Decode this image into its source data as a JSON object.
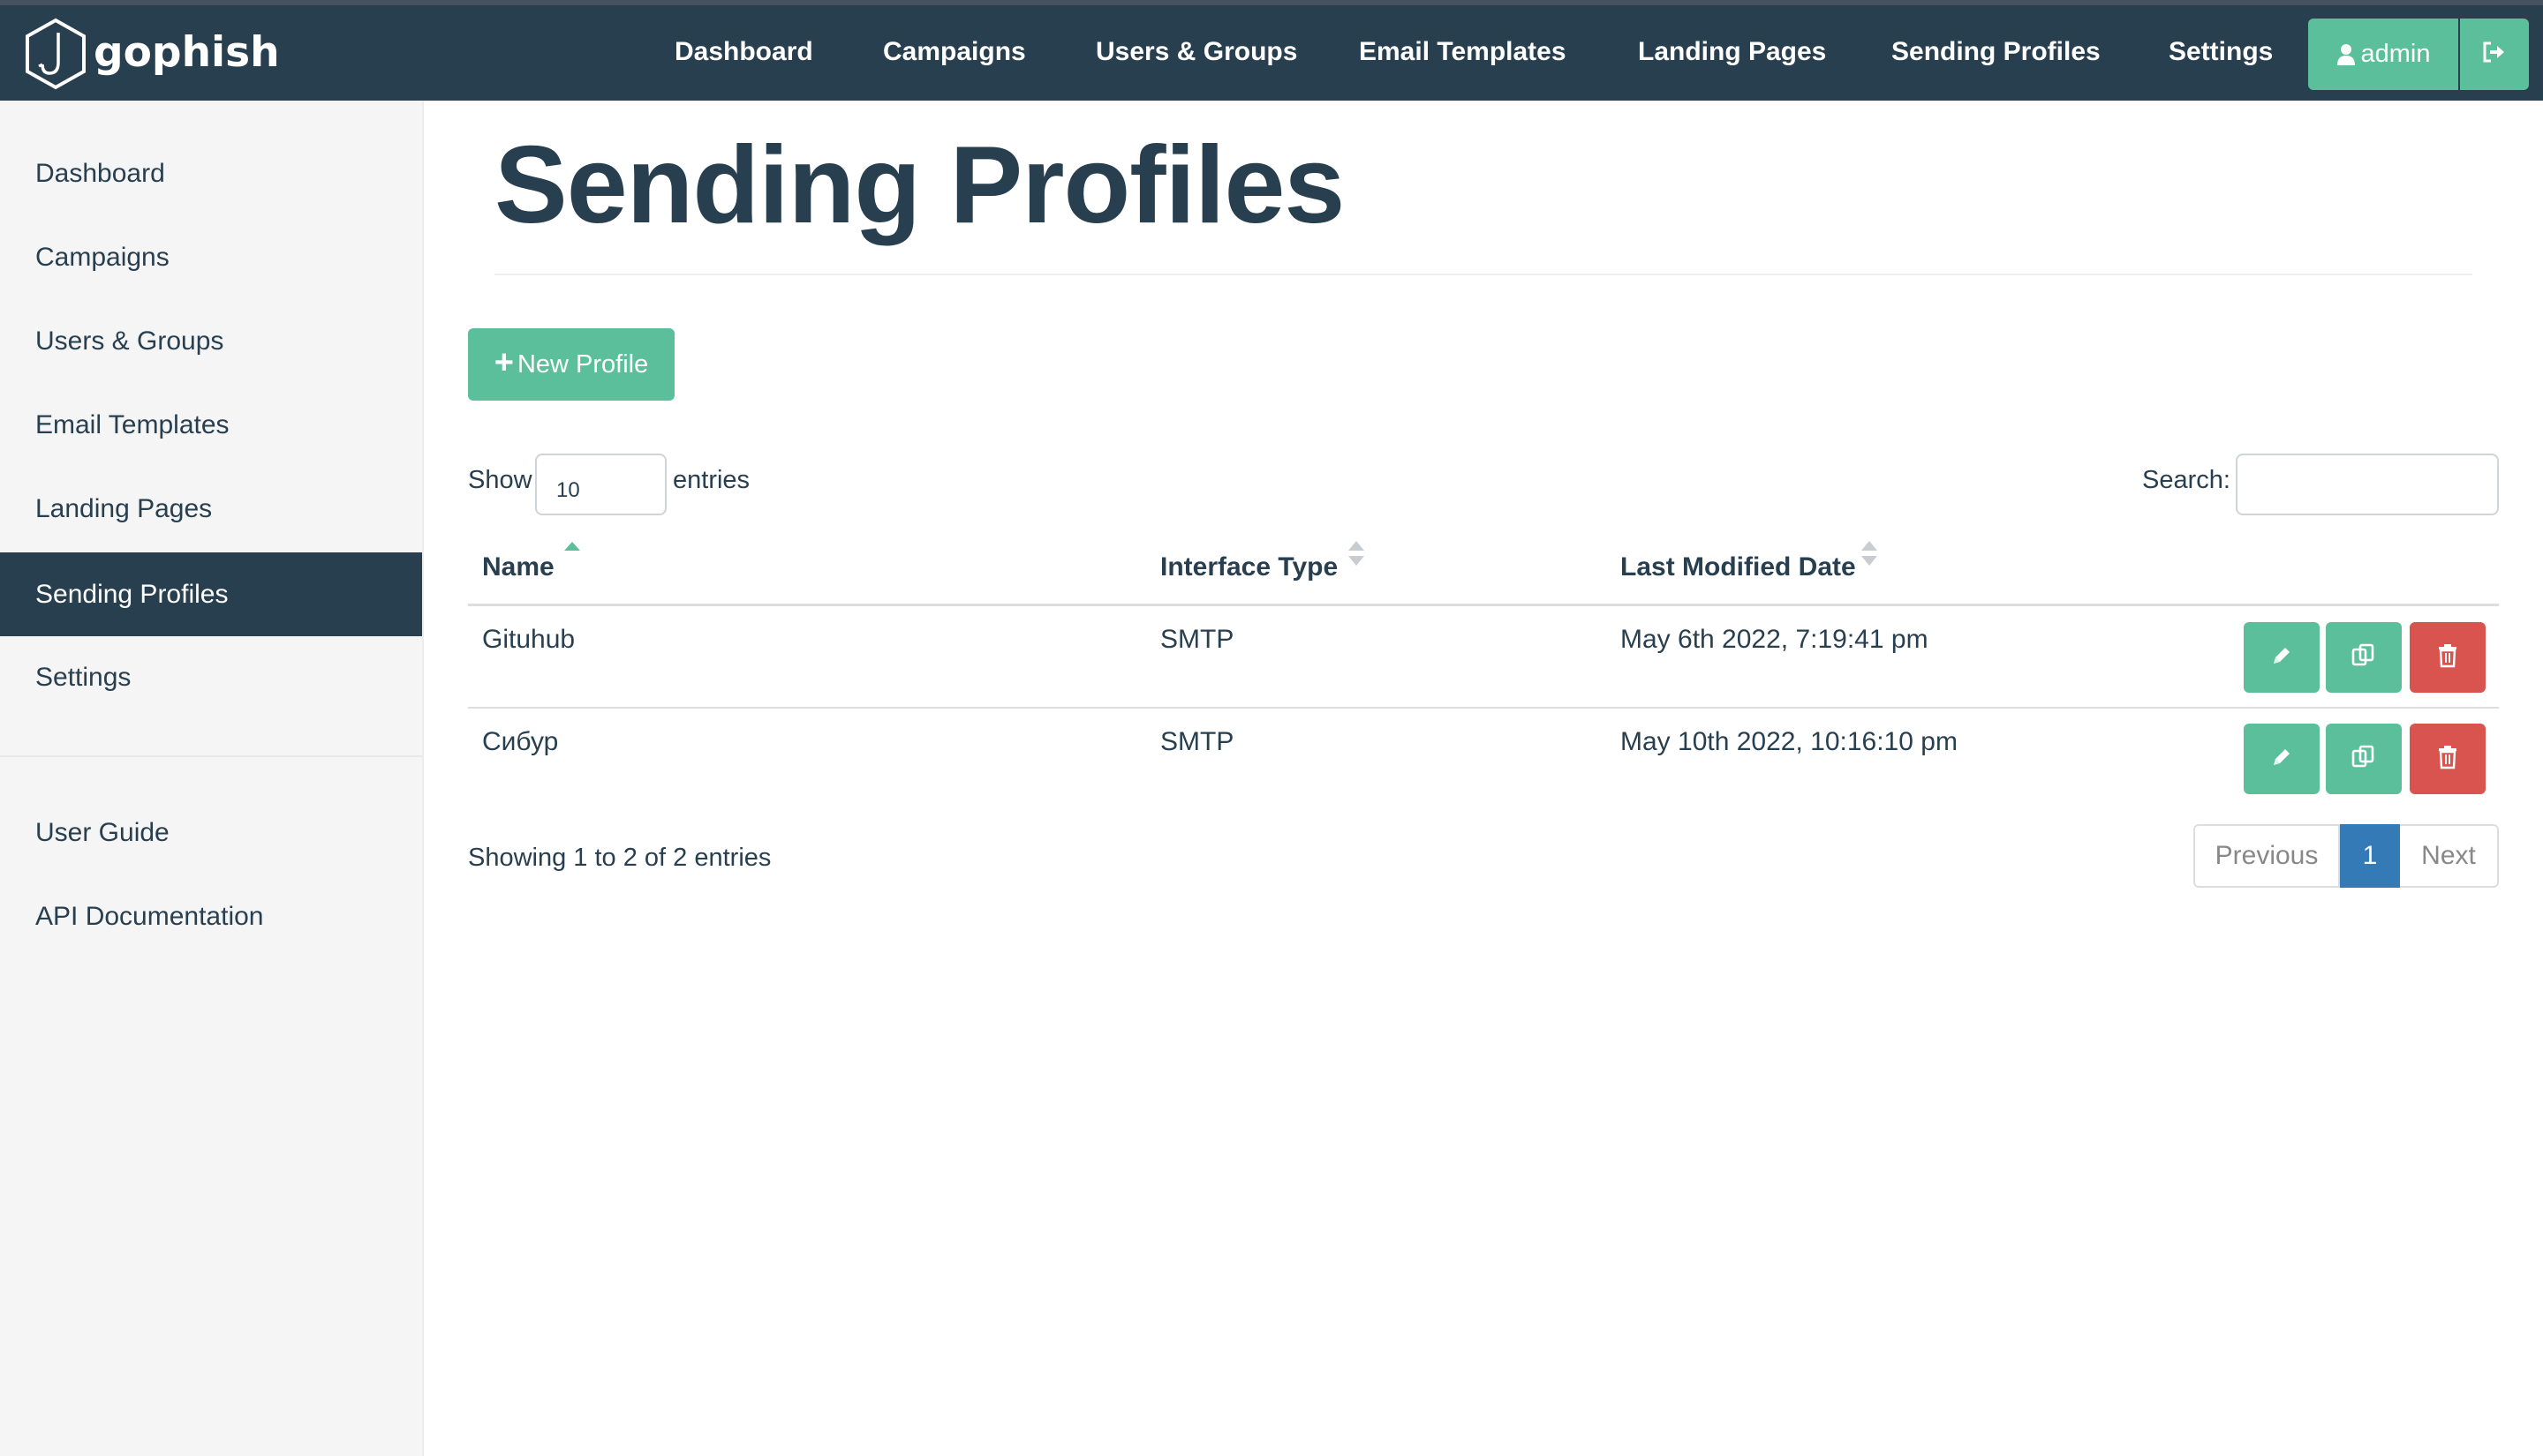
{
  "brand": {
    "name": "gophish"
  },
  "navbar": {
    "links": [
      "Dashboard",
      "Campaigns",
      "Users & Groups",
      "Email Templates",
      "Landing Pages",
      "Sending Profiles",
      "Settings"
    ],
    "user_label": "admin"
  },
  "sidebar": {
    "items": [
      "Dashboard",
      "Campaigns",
      "Users & Groups",
      "Email Templates",
      "Landing Pages",
      "Sending Profiles",
      "Settings"
    ],
    "active_item": "Sending Profiles",
    "help_items": [
      "User Guide",
      "API Documentation"
    ]
  },
  "page": {
    "title": "Sending Profiles",
    "new_button_label": "New Profile"
  },
  "table_controls": {
    "show_label": "Show",
    "page_length": "10",
    "entries_label": "entries",
    "search_label": "Search:",
    "search_value": ""
  },
  "table": {
    "columns": [
      "Name",
      "Interface Type",
      "Last Modified Date"
    ],
    "sorted_column": "Name",
    "sort_direction": "ascending",
    "rows": [
      {
        "name": "Gituhub",
        "interface_type": "SMTP",
        "last_modified": "May 6th 2022, 7:19:41 pm"
      },
      {
        "name": "Сибур",
        "interface_type": "SMTP",
        "last_modified": "May 10th 2022, 10:16:10 pm"
      }
    ],
    "row_actions": [
      "edit-icon",
      "copy-icon",
      "trash-icon"
    ]
  },
  "pagination": {
    "info": "Showing 1 to 2 of 2 entries",
    "previous_label": "Previous",
    "current_page": "1",
    "next_label": "Next"
  },
  "colors": {
    "navbar_bg": "#283f50",
    "accent_green": "#5cbf9c",
    "danger_red": "#d9534f",
    "active_page_blue": "#337ab7"
  }
}
